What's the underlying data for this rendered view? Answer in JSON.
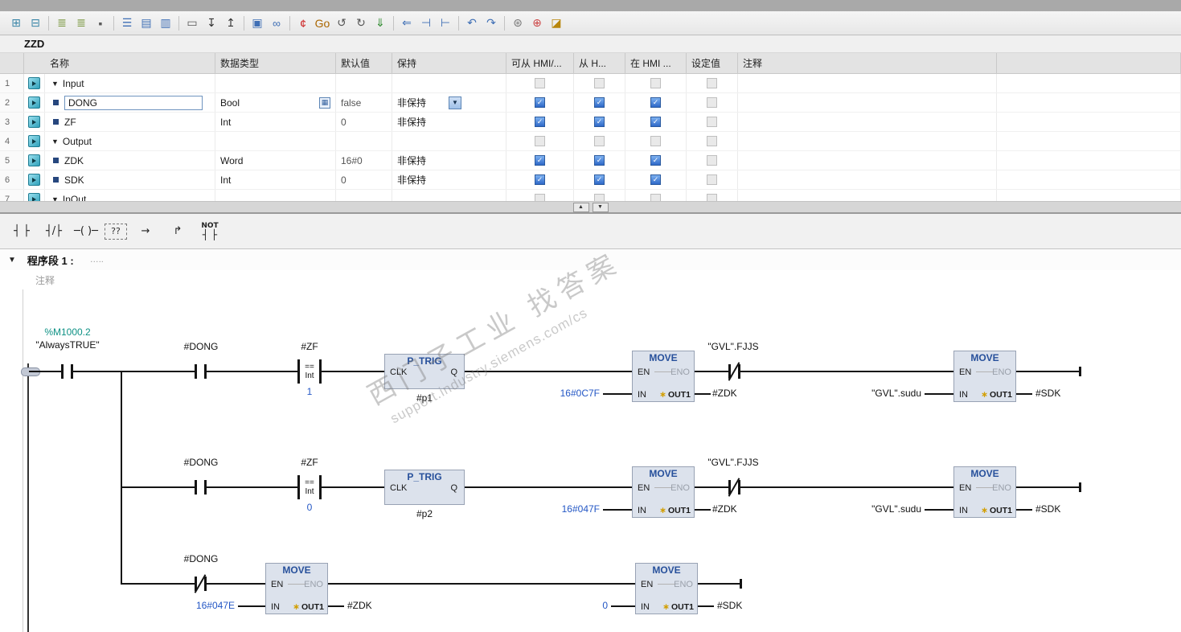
{
  "block_name": "ZZD",
  "ui": {
    "picker_glyph": "▦",
    "combo_arrow": "▼",
    "splitter_up": "▲",
    "splitter_down": "▼",
    "network_collapse": "▼",
    "section_collapse": "▼"
  },
  "toolbar": {
    "icons": [
      {
        "name": "insert-row-icon",
        "glyph": "⊞",
        "color": "#3b86a8"
      },
      {
        "name": "delete-row-icon",
        "glyph": "⊟",
        "color": "#3b86a8",
        "sep": true
      },
      {
        "name": "reset-start-values-icon",
        "glyph": "≣",
        "color": "#7d9a45"
      },
      {
        "name": "update-start-values-icon",
        "glyph": "≣",
        "color": "#7d9a45"
      },
      {
        "name": "keep-actual-values-icon",
        "glyph": "▪",
        "color": "#5a5a5a",
        "sep": true
      },
      {
        "name": "expand-all-icon",
        "glyph": "☰",
        "color": "#3f6fb5"
      },
      {
        "name": "snapshot-icon",
        "glyph": "▤",
        "color": "#3f6fb5"
      },
      {
        "name": "apply-snapshot-icon",
        "glyph": "▥",
        "color": "#3f6fb5",
        "sep": true
      },
      {
        "name": "comment-icon",
        "glyph": "▭",
        "color": "#555555"
      },
      {
        "name": "download-values-icon",
        "glyph": "↧",
        "color": "#333333"
      },
      {
        "name": "upload-values-icon",
        "glyph": "↥",
        "color": "#333333",
        "sep": true
      },
      {
        "name": "expand-box-icon",
        "glyph": "▣",
        "color": "#3f6fb5"
      },
      {
        "name": "monitor-on-off-icon",
        "glyph": "∞",
        "color": "#3f6fb5",
        "sep": true
      },
      {
        "name": "break-call-icon",
        "glyph": "¢",
        "color": "#cc2222"
      },
      {
        "name": "go-online-icon",
        "glyph": "Go",
        "color": "#aa6600"
      },
      {
        "name": "load-from-device-icon",
        "glyph": "↺",
        "color": "#555555"
      },
      {
        "name": "load-to-device-icon",
        "glyph": "↻",
        "color": "#555555"
      },
      {
        "name": "compile-icon",
        "glyph": "⇓",
        "color": "#2e8b2e",
        "sep": true
      },
      {
        "name": "goto-previous-icon",
        "glyph": "⇐",
        "color": "#3f6fb5"
      },
      {
        "name": "align-left-icon",
        "glyph": "⊣",
        "color": "#3f6fb5"
      },
      {
        "name": "align-right-icon",
        "glyph": "⊢",
        "color": "#3f6fb5",
        "sep": true
      },
      {
        "name": "goto-first-icon",
        "glyph": "↶",
        "color": "#3f6fb5"
      },
      {
        "name": "goto-last-icon",
        "glyph": "↷",
        "color": "#3f6fb5",
        "sep": true
      },
      {
        "name": "settings-icon",
        "glyph": "⊛",
        "color": "#777777"
      },
      {
        "name": "connection-icon",
        "glyph": "⊕",
        "color": "#cc4444"
      },
      {
        "name": "edit-db-icon",
        "glyph": "◪",
        "color": "#b8860b"
      }
    ]
  },
  "var_table": {
    "headers": {
      "name": "名称",
      "type": "数据类型",
      "default": "默认值",
      "retain": "保持",
      "acc": "可从 HMI/...",
      "wr": "从 H...",
      "vis": "在 HMI ...",
      "set": "设定值",
      "comment": "注释"
    },
    "rows": [
      {
        "num": "1",
        "name": "Input",
        "cb": "disabled",
        "cb_set": "disabled"
      },
      {
        "num": "2",
        "name": "DONG",
        "type": "Bool",
        "default": "false",
        "retain": "非保持",
        "cb": "checked",
        "cb_set": "disabled"
      },
      {
        "num": "3",
        "name": "ZF",
        "type": "Int",
        "default": "0",
        "retain": "非保持",
        "cb": "checked",
        "cb_set": "disabled"
      },
      {
        "num": "4",
        "name": "Output",
        "cb": "disabled",
        "cb_set": "disabled"
      },
      {
        "num": "5",
        "name": "ZDK",
        "type": "Word",
        "default": "16#0",
        "retain": "非保持",
        "cb": "checked",
        "cb_set": "disabled"
      },
      {
        "num": "6",
        "name": "SDK",
        "type": "Int",
        "default": "0",
        "retain": "非保持",
        "cb": "checked",
        "cb_set": "disabled"
      },
      {
        "num": "7",
        "name": "InOut",
        "cb": "disabled",
        "cb_set": "disabled"
      }
    ]
  },
  "lad_toolbar": {
    "items": [
      {
        "name": "no-contact-button",
        "glyph": "┤ ├"
      },
      {
        "name": "nc-contact-button",
        "glyph": "┤/├"
      },
      {
        "name": "coil-button",
        "glyph": "─( )─"
      },
      {
        "name": "empty-box-button",
        "glyph": "??",
        "box": true
      },
      {
        "name": "open-branch-button",
        "glyph": "→"
      },
      {
        "name": "close-branch-button",
        "glyph": "↱"
      },
      {
        "name": "not-contact-button",
        "glyph": "NOT",
        "sub": "┤ ├"
      }
    ]
  },
  "network": {
    "title": "程序段 1 :",
    "subtitle": "…..",
    "comment_placeholder": "注释"
  },
  "ladder": {
    "rungs": [
      {
        "always_addr": "%M1000.2",
        "always_name": "\"AlwaysTRUE\"",
        "dong": "#DONG",
        "cmp_tag": "#ZF",
        "cmp_op": "==",
        "cmp_type": "Int",
        "cmp_value": "1",
        "ptrig_title": "P_TRIG",
        "ptrig_clk": "CLK",
        "ptrig_q": "Q",
        "ptrig_inst": "#p1",
        "move1_title": "MOVE",
        "move1_en": "EN",
        "move1_eno": "ENO",
        "move1_in": "IN",
        "move1_out": "OUT1",
        "move1_in_val": "16#0C7F",
        "move1_out_tag": "#ZDK",
        "nc_tag": "\"GVL\".FJJS",
        "move2_title": "MOVE",
        "move2_en": "EN",
        "move2_eno": "ENO",
        "move2_in": "IN",
        "move2_out": "OUT1",
        "move2_in_val": "\"GVL\".sudu",
        "move2_out_tag": "#SDK"
      },
      {
        "dong": "#DONG",
        "cmp_tag": "#ZF",
        "cmp_op": "==",
        "cmp_type": "Int",
        "cmp_value": "0",
        "ptrig_title": "P_TRIG",
        "ptrig_clk": "CLK",
        "ptrig_q": "Q",
        "ptrig_inst": "#p2",
        "move1_title": "MOVE",
        "move1_en": "EN",
        "move1_eno": "ENO",
        "move1_in": "IN",
        "move1_out": "OUT1",
        "move1_in_val": "16#047F",
        "move1_out_tag": "#ZDK",
        "nc_tag": "\"GVL\".FJJS",
        "move2_title": "MOVE",
        "move2_en": "EN",
        "move2_eno": "ENO",
        "move2_in": "IN",
        "move2_out": "OUT1",
        "move2_in_val": "\"GVL\".sudu",
        "move2_out_tag": "#SDK"
      },
      {
        "dong": "#DONG",
        "move1_title": "MOVE",
        "move1_en": "EN",
        "move1_eno": "ENO",
        "move1_in": "IN",
        "move1_out": "OUT1",
        "move1_in_val": "16#047E",
        "move1_out_tag": "#ZDK",
        "move2_title": "MOVE",
        "move2_en": "EN",
        "move2_eno": "ENO",
        "move2_in": "IN",
        "move2_out": "OUT1",
        "move2_in_val": "0",
        "move2_out_tag": "#SDK"
      }
    ]
  },
  "watermark": {
    "line1": "西门子工业  找答案",
    "line2": "support.industry.siemens.com/cs"
  }
}
